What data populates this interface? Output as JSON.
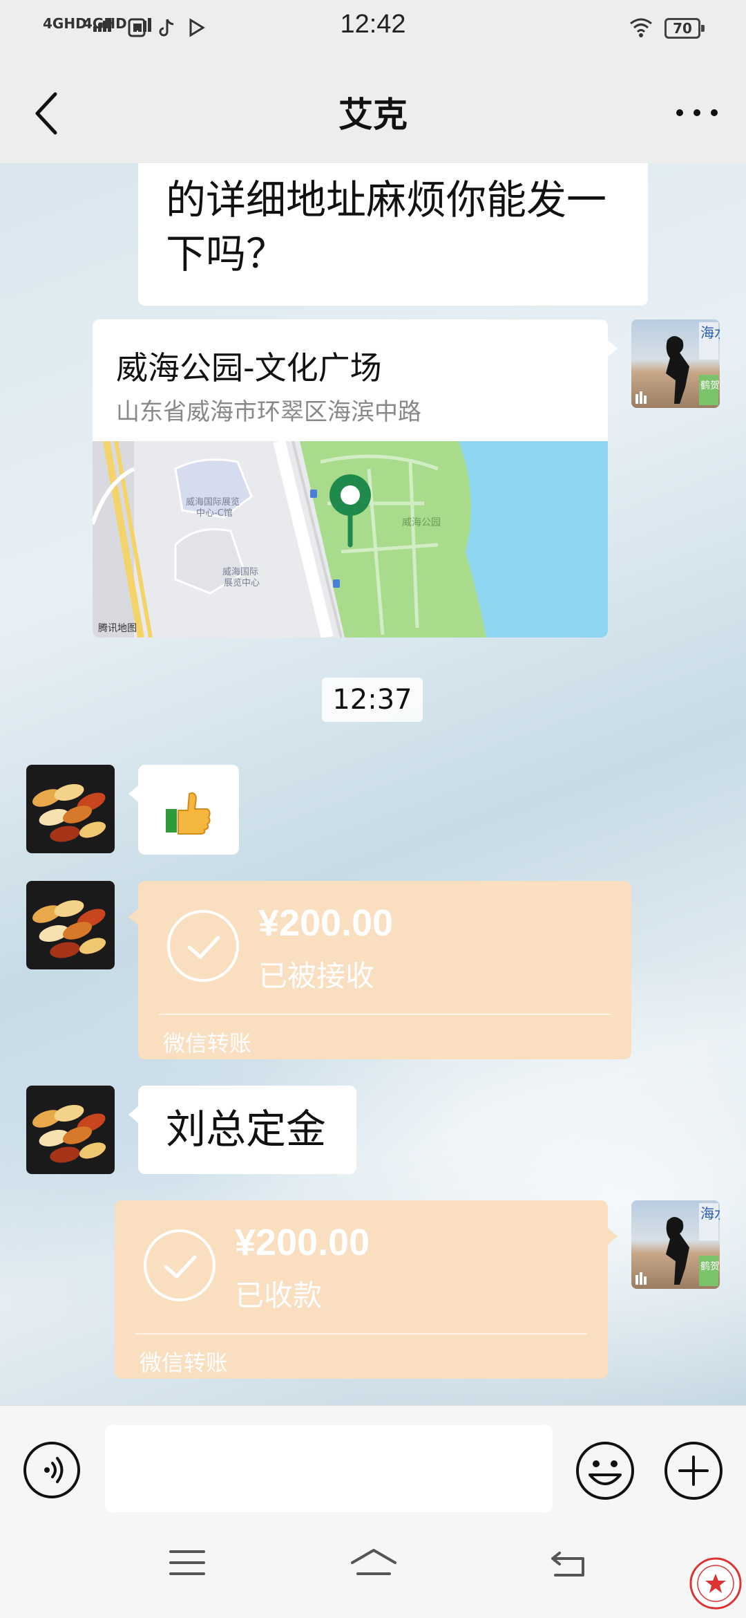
{
  "status_bar": {
    "network_1": "4GHD",
    "network_2": "4GHD",
    "time": "12:42",
    "battery": "70"
  },
  "header": {
    "title": "艾克"
  },
  "messages": {
    "partial_text": "的详细地址麻烦你能发一下吗？",
    "location": {
      "name": "威海公园-文化广场",
      "address": "山东省威海市环翠区海滨中路",
      "map_labels": [
        "威海国际展览中心-C馆",
        "威海国际展览中心",
        "威海公园"
      ],
      "map_credit": "腾讯地图"
    },
    "timestamp": "12:37",
    "thumbs_emoji": "👍",
    "transfer_1": {
      "amount": "¥200.00",
      "status": "已被接收",
      "label": "微信转账"
    },
    "deposit_text": "刘总定金",
    "transfer_2": {
      "amount": "¥200.00",
      "status": "已收款",
      "label": "微信转账"
    }
  },
  "avatar_text": {
    "man_sign": "海水",
    "man_sign_2": "鹤贺"
  },
  "colors": {
    "transfer_bg": "#f9dfc0",
    "map_water": "#8fd6f0",
    "map_park": "#a8dc8c",
    "pin": "#1f8a4c"
  },
  "icons": [
    "back-icon",
    "more-icon",
    "voice-icon",
    "emoji-icon",
    "plus-icon",
    "nav-menu-icon",
    "nav-home-icon",
    "nav-back-icon"
  ]
}
